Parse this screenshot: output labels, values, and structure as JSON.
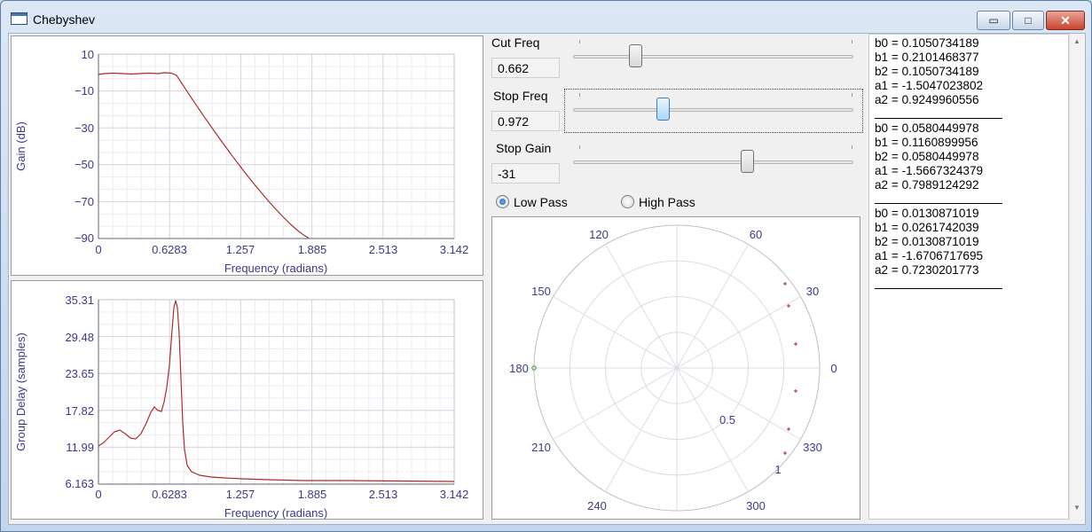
{
  "window": {
    "title": "Chebyshev",
    "buttons": {
      "minimize": "▭",
      "maximize": "□",
      "close": "✕"
    }
  },
  "gain_plot": {
    "ylabel": "Gain (dB)",
    "xlabel": "Frequency (radians)",
    "yticks": [
      "10",
      "−10",
      "−30",
      "−50",
      "−70",
      "−90"
    ],
    "xticks": [
      "0",
      "0.6283",
      "1.257",
      "1.885",
      "2.513",
      "3.142"
    ]
  },
  "delay_plot": {
    "ylabel": "Group Delay (samples)",
    "xlabel": "Frequency (radians)",
    "yticks": [
      "35.31",
      "29.48",
      "23.65",
      "17.82",
      "11.99",
      "6.163"
    ],
    "xticks": [
      "0",
      "0.6283",
      "1.257",
      "1.885",
      "2.513",
      "3.142"
    ]
  },
  "controls": {
    "cut_freq": {
      "label": "Cut Freq",
      "value": "0.662",
      "position": 0.22
    },
    "stop_freq": {
      "label": "Stop Freq",
      "value": "0.972",
      "position": 0.32
    },
    "stop_gain": {
      "label": "Stop Gain",
      "value": "-31",
      "position": 0.62
    },
    "filter_type": {
      "low_pass": "Low Pass",
      "high_pass": "High Pass",
      "selected": "low"
    }
  },
  "polar_plot": {
    "angle_labels": [
      "0",
      "30",
      "60",
      "120",
      "150",
      "180",
      "210",
      "240",
      "300",
      "330"
    ],
    "radius_labels": [
      "0.5",
      "1"
    ]
  },
  "coefficients": {
    "sections": [
      [
        "b0 = 0.1050734189",
        "b1 = 0.2101468377",
        "b2 = 0.1050734189",
        "a1 = -1.5047023802",
        "a2 = 0.9249960556"
      ],
      [
        "b0 = 0.0580449978",
        "b1 = 0.1160899956",
        "b2 = 0.0580449978",
        "a1 = -1.5667324379",
        "a2 = 0.7989124292"
      ],
      [
        "b0 = 0.0130871019",
        "b1 = 0.0261742039",
        "b2 = 0.0130871019",
        "a1 = -1.6706717695",
        "a2 = 0.7230201773"
      ]
    ]
  },
  "colors": {
    "plot_line": "#b02a2a",
    "axis_text": "#3a3a8a",
    "grid": "#e3e3ee"
  }
}
